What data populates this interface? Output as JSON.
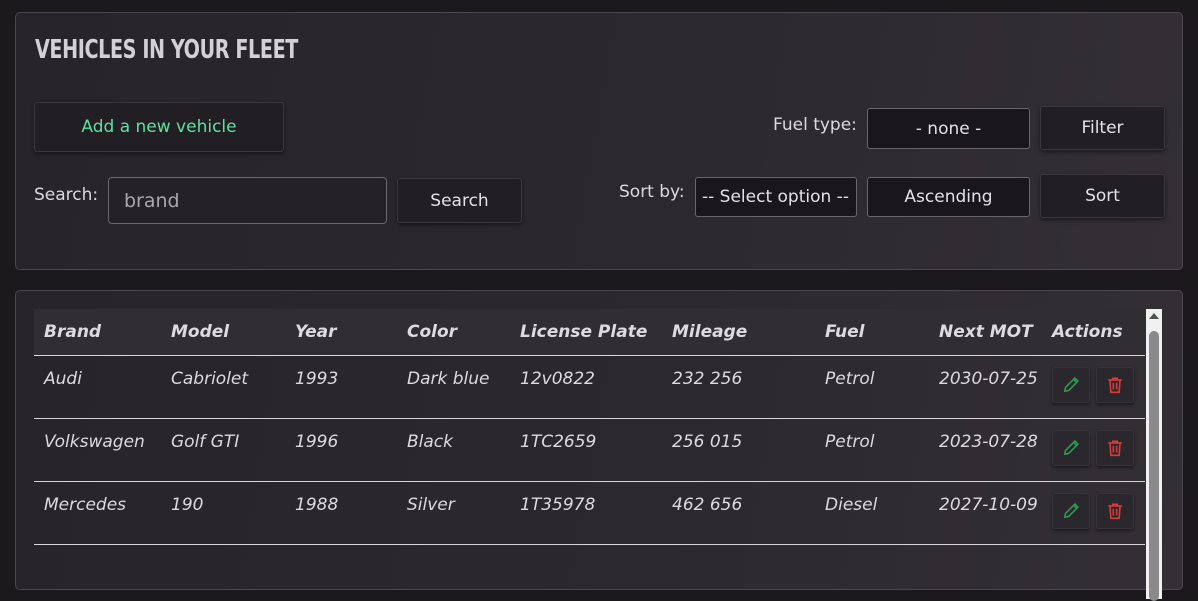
{
  "header": {
    "title": "VEHICLES IN YOUR FLEET"
  },
  "toolbar": {
    "add_label": "Add a new vehicle",
    "search_label": "Search:",
    "search_placeholder": "brand",
    "search_button": "Search",
    "fuel_label": "Fuel type:",
    "fuel_selected": "- none -",
    "filter_button": "Filter",
    "sort_label": "Sort by:",
    "sort_selected": "-- Select option --",
    "order_selected": "Ascending",
    "sort_button": "Sort"
  },
  "table": {
    "columns": [
      "Brand",
      "Model",
      "Year",
      "Color",
      "License Plate",
      "Mileage",
      "Fuel",
      "Next MOT",
      "Actions"
    ],
    "rows": [
      {
        "brand": "Audi",
        "model": "Cabriolet",
        "year": "1993",
        "color": "Dark blue",
        "plate": "12v0822",
        "mileage": "232 256",
        "fuel": "Petrol",
        "mot": "2030-07-25"
      },
      {
        "brand": "Volkswagen",
        "model": "Golf GTI",
        "year": "1996",
        "color": "Black",
        "plate": "1TC2659",
        "mileage": "256 015",
        "fuel": "Petrol",
        "mot": "2023-07-28"
      },
      {
        "brand": "Mercedes",
        "model": "190",
        "year": "1988",
        "color": "Silver",
        "plate": "1T35978",
        "mileage": "462 656",
        "fuel": "Diesel",
        "mot": "2027-10-09"
      }
    ]
  },
  "icons": {
    "edit": "pencil-icon",
    "delete": "trash-icon"
  },
  "colors": {
    "accent_green": "#5ee0a0",
    "edit_green": "#2e9a52",
    "delete_red": "#d93a3a"
  }
}
